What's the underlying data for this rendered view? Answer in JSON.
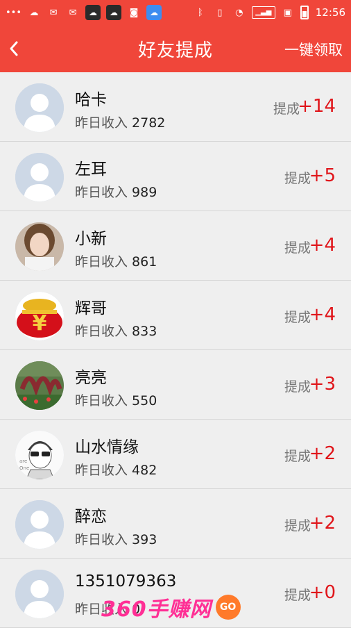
{
  "status_bar": {
    "left_icons": [
      "more-dots-icon",
      "cloud-icon",
      "wechat-icon",
      "wechat-icon",
      "cloud-box-icon",
      "cloud-box-icon",
      "camera-icon",
      "cloud-app-icon"
    ],
    "right_icons": [
      "bluetooth-icon",
      "phone-signal-icon",
      "wifi-icon",
      "cell-signal-icon",
      "sim-icon",
      "battery-icon"
    ],
    "time": "12:56"
  },
  "navbar": {
    "title": "好友提成",
    "action": "一键领取",
    "back_icon": "back-arrow-icon"
  },
  "colors": {
    "accent": "#f0463a",
    "commission": "#e0151a"
  },
  "income_label": "昨日收入",
  "commission_label": "提成",
  "friends": [
    {
      "name": "哈卡",
      "income": "2782",
      "commission": "+14",
      "avatar": "default-avatar"
    },
    {
      "name": "左耳",
      "income": "989",
      "commission": "+5",
      "avatar": "default-avatar"
    },
    {
      "name": "小新",
      "income": "861",
      "commission": "+4",
      "avatar": "photo-girl"
    },
    {
      "name": "辉哥",
      "income": "833",
      "commission": "+4",
      "avatar": "yuan-bag"
    },
    {
      "name": "亮亮",
      "income": "550",
      "commission": "+3",
      "avatar": "photo-garden"
    },
    {
      "name": "山水情缘",
      "income": "482",
      "commission": "+2",
      "avatar": "cartoon-boy"
    },
    {
      "name": "醉恋",
      "income": "393",
      "commission": "+2",
      "avatar": "default-avatar"
    },
    {
      "name": "1351079363",
      "income": "0",
      "commission": "+0",
      "avatar": "default-avatar"
    }
  ],
  "watermark": {
    "text": "360手赚网",
    "badge": "GO"
  }
}
